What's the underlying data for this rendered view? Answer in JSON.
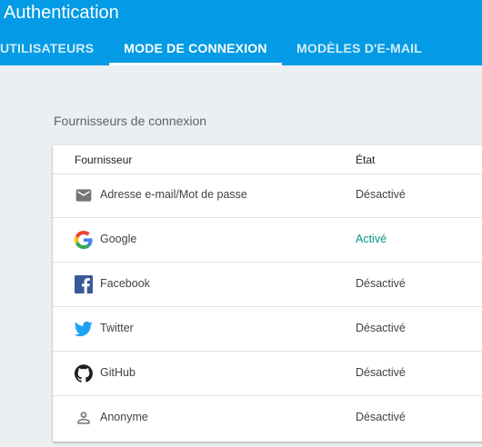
{
  "app": {
    "title": "Authentication"
  },
  "tabs": [
    {
      "label": "UTILISATEURS",
      "active": false
    },
    {
      "label": "MODE DE CONNEXION",
      "active": true
    },
    {
      "label": "MODÈLES D'E-MAIL",
      "active": false
    }
  ],
  "section": {
    "title": "Fournisseurs de connexion"
  },
  "table": {
    "headers": {
      "provider": "Fournisseur",
      "state": "État"
    },
    "rows": [
      {
        "icon": "email-icon",
        "name": "Adresse e-mail/Mot de passe",
        "state": "Désactivé",
        "enabled": false
      },
      {
        "icon": "google-icon",
        "name": "Google",
        "state": "Activé",
        "enabled": true
      },
      {
        "icon": "facebook-icon",
        "name": "Facebook",
        "state": "Désactivé",
        "enabled": false
      },
      {
        "icon": "twitter-icon",
        "name": "Twitter",
        "state": "Désactivé",
        "enabled": false
      },
      {
        "icon": "github-icon",
        "name": "GitHub",
        "state": "Désactivé",
        "enabled": false
      },
      {
        "icon": "anonymous-person-icon",
        "name": "Anonyme",
        "state": "Désactivé",
        "enabled": false
      }
    ]
  },
  "colors": {
    "appbar": "#039be5",
    "background": "#eceff1",
    "enabled_state": "#009688",
    "facebook": "#3b5998",
    "twitter": "#1da1f2"
  }
}
